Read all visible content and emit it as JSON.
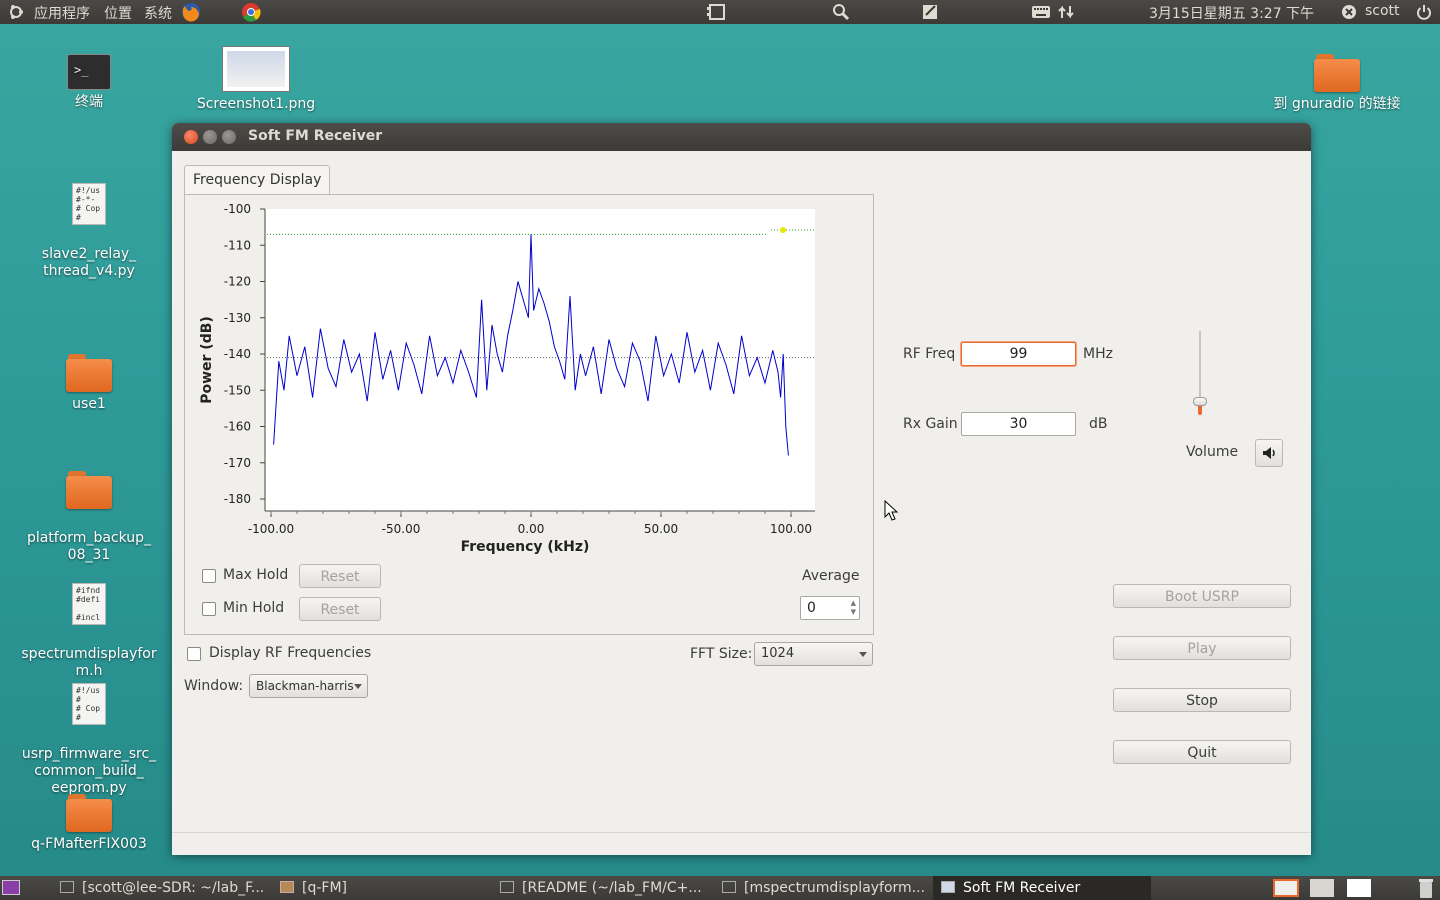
{
  "top_panel": {
    "applications": "应用程序",
    "places": "位置",
    "system": "系统",
    "datetime": "3月15日星期五 3:27 下午",
    "user": "scott"
  },
  "desktop": {
    "icons": [
      {
        "label": "终端"
      },
      {
        "label": "Screenshot1.png"
      },
      {
        "label": "到 gnuradio 的链接"
      },
      {
        "label": "slave2_relay_\nthread_v4.py",
        "preview": "#!/us\n#-*-\n# Cop\n#"
      },
      {
        "label": "use1"
      },
      {
        "label": "platform_backup_\n08_31"
      },
      {
        "label": "spectrumdisplayfor\nm.h",
        "preview": "#ifnd\n#defi\n\n#incl"
      },
      {
        "label": "usrp_firmware_src_\ncommon_build_\neeprom.py",
        "preview": "#!/us\n#\n# Cop\n#"
      },
      {
        "label": "q-FMafterFIX003"
      }
    ]
  },
  "window": {
    "title": "Soft FM Receiver",
    "tab": "Frequency Display",
    "max_hold": "Max Hold",
    "min_hold": "Min Hold",
    "reset": "Reset",
    "average_label": "Average",
    "average_value": "0",
    "display_rf": "Display RF Frequencies",
    "fft_size_label": "FFT Size:",
    "fft_size_value": "1024",
    "window_label": "Window:",
    "window_value": "Blackman-harris",
    "rf_freq_label": "RF Freq",
    "rf_freq_value": "99",
    "rf_freq_unit": "MHz",
    "rx_gain_label": "Rx Gain",
    "rx_gain_value": "30",
    "rx_gain_unit": "dB",
    "volume_label": "Volume",
    "volume_level": 0.15,
    "boot_usrp": "Boot USRP",
    "play": "Play",
    "stop": "Stop",
    "quit": "Quit"
  },
  "taskbar": {
    "tasks": [
      "[scott@lee-SDR: ~/lab_F...",
      "[q-FM]",
      "[README (~/lab_FM/C+...",
      "[mspectrumdisplayform...",
      "Soft FM Receiver"
    ]
  },
  "chart_data": {
    "type": "line",
    "xlabel": "Frequency (kHz)",
    "ylabel": "Power (dB)",
    "xlim": [
      -100,
      100
    ],
    "ylim": [
      -180,
      -100
    ],
    "x_ticks": [
      "-100.00",
      "-50.00",
      "0.00",
      "50.00",
      "100.00"
    ],
    "y_ticks": [
      "-100",
      "-110",
      "-120",
      "-130",
      "-140",
      "-150",
      "-160",
      "-170",
      "-180"
    ],
    "series": [
      {
        "color": "#0000cc",
        "x": [
          -99,
          -97,
          -95,
          -93,
          -90,
          -87,
          -84,
          -81,
          -78,
          -75,
          -72,
          -69,
          -66,
          -63,
          -60,
          -57,
          -54,
          -51,
          -48,
          -45,
          -42,
          -39,
          -36,
          -33,
          -30,
          -27,
          -24,
          -21,
          -19,
          -17,
          -15,
          -13,
          -11,
          -9,
          -7,
          -5,
          -3,
          -1,
          0,
          1,
          3,
          5,
          7,
          9,
          11,
          13,
          15,
          17,
          19,
          21,
          24,
          27,
          30,
          33,
          36,
          39,
          42,
          45,
          48,
          51,
          54,
          57,
          60,
          63,
          66,
          69,
          72,
          75,
          78,
          81,
          84,
          87,
          90,
          93,
          95,
          96,
          97,
          98,
          99
        ],
        "y": [
          -165,
          -142,
          -150,
          -135,
          -146,
          -138,
          -152,
          -133,
          -144,
          -149,
          -136,
          -145,
          -140,
          -153,
          -134,
          -147,
          -139,
          -150,
          -137,
          -143,
          -151,
          -135,
          -146,
          -141,
          -148,
          -139,
          -145,
          -152,
          -125,
          -150,
          -132,
          -140,
          -145,
          -135,
          -128,
          -120,
          -125,
          -130,
          -107,
          -128,
          -122,
          -126,
          -131,
          -138,
          -142,
          -147,
          -124,
          -150,
          -140,
          -146,
          -138,
          -151,
          -136,
          -144,
          -149,
          -137,
          -142,
          -153,
          -135,
          -146,
          -140,
          -148,
          -134,
          -145,
          -139,
          -150,
          -137,
          -143,
          -151,
          -135,
          -146,
          -141,
          -148,
          -139,
          -145,
          -152,
          -140,
          -160,
          -168
        ]
      }
    ],
    "max_hold_level": -107
  }
}
